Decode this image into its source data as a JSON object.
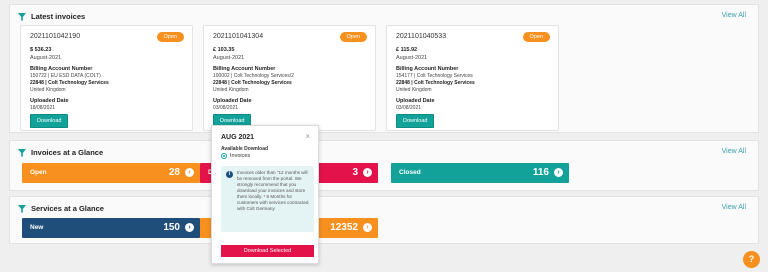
{
  "latest_invoices": {
    "title": "Latest invoices",
    "view_all": "View All",
    "cards": [
      {
        "number": "2021101042190",
        "status": "Open",
        "amount": "$ 536.23",
        "month": "August-2021",
        "ban_label": "Billing Account Number",
        "ban_value": "150722 | EU ESD DATA (COLT)",
        "company": "22848 | Colt Technology Services",
        "country": "United Kingdom",
        "uploaded_label": "Uploaded Date",
        "uploaded_value": "18/08/2021",
        "download": "Download"
      },
      {
        "number": "2021101041304",
        "status": "Open",
        "amount": "£ 103.35",
        "month": "August-2021",
        "ban_label": "Billing Account Number",
        "ban_value": "100002 | Colt Technology Services/2",
        "company": "22848 | Colt Technology Services",
        "country": "United Kingdom",
        "uploaded_label": "Uploaded Date",
        "uploaded_value": "03/08/2021",
        "download": "Download"
      },
      {
        "number": "2021101040533",
        "status": "Open",
        "amount": "£ 115.92",
        "month": "August-2021",
        "ban_label": "Billing Account Number",
        "ban_value": "154177 | Colt Technology Services",
        "company": "22848 | Colt Technology Services",
        "country": "United Kingdom",
        "uploaded_label": "Uploaded Date",
        "uploaded_value": "03/08/2021",
        "download": "Download"
      }
    ]
  },
  "invoices_glance": {
    "title": "Invoices at a Glance",
    "view_all": "View All",
    "tiles": [
      {
        "label": "Open",
        "count": "28",
        "color": "#f7901e"
      },
      {
        "label": "D",
        "count": "3",
        "color": "#e3124b"
      },
      {
        "label": "Closed",
        "count": "116",
        "color": "#13a29a"
      }
    ]
  },
  "services_glance": {
    "title": "Services at a Glance",
    "view_all": "View All",
    "tiles": [
      {
        "label": "New",
        "count": "150",
        "color": "#1f4e7a"
      },
      {
        "label": "",
        "count": "12352",
        "color": "#f7901e"
      }
    ]
  },
  "popup": {
    "title": "AUG 2021",
    "close": "×",
    "available": "Available Download",
    "option": "Invoices",
    "info": "Invoices older than \"12 months will be removed from the portal. We strongly recommend that you download your invoices and store them locally. * 6 Months for customers with services contracted with Colt Germany",
    "download_selected": "Download Selected"
  },
  "help": {
    "label": "?"
  },
  "colors": {
    "accent_teal": "#13a29a",
    "accent_orange": "#f7901e",
    "accent_red": "#e3124b",
    "accent_navy": "#1f4e7a",
    "link": "#3a9fb0"
  }
}
